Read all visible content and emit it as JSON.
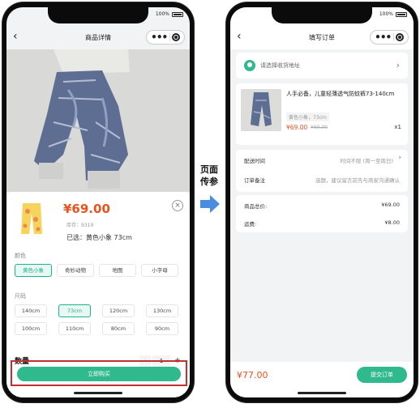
{
  "status": {
    "battery": "100%"
  },
  "left": {
    "nav_title": "商品详情",
    "back_icon": "back-arrow-icon",
    "price": "¥69.00",
    "stock": "库存：9319",
    "selected": "已选：黄色小象 73cm",
    "color_title": "颜色",
    "colors": [
      {
        "label": "黄色小象",
        "active": true
      },
      {
        "label": "奇妙动物",
        "active": false
      },
      {
        "label": "地图",
        "active": false
      },
      {
        "label": "小字母",
        "active": false
      }
    ],
    "size_title": "尺码",
    "sizes": [
      {
        "label": "140cm",
        "active": false
      },
      {
        "label": "73cm",
        "active": true
      },
      {
        "label": "120cm",
        "active": false
      },
      {
        "label": "130cm",
        "active": false
      },
      {
        "label": "100cm",
        "active": false
      },
      {
        "label": "110cm",
        "active": false
      },
      {
        "label": "80cm",
        "active": false
      },
      {
        "label": "90cm",
        "active": false
      }
    ],
    "quantity_label": "数量",
    "quantity": "1",
    "minus": "-",
    "plus": "+",
    "buy_label": "立即购买",
    "close_icon": "close-icon"
  },
  "middle": {
    "label_line1": "页面",
    "label_line2": "传参",
    "arrow_color": "#4a8de0"
  },
  "right": {
    "nav_title": "填写订单",
    "address_placeholder": "请选择收货地址",
    "product_name": "人手必备，儿童轻薄透气防蚊裤73-140cm",
    "spec": "黄色小象，73cm",
    "price": "¥69.00",
    "old_price": "¥69.00",
    "qty": "x1",
    "delivery_label": "配送时间",
    "delivery_value": "时间不限 (周一至周日)",
    "note_label": "订单备注",
    "note_placeholder": "选题，建议留言前先与商家沟通确认",
    "total_label": "商品总价:",
    "total_value": "¥69.00",
    "shipping_label": "运费:",
    "shipping_value": "¥8.00",
    "final_price": "¥77.00",
    "submit_label": "提交订单"
  },
  "colors": {
    "accent": "#2fb98d",
    "price": "#e8541f",
    "highlight": "#c42f2f"
  }
}
